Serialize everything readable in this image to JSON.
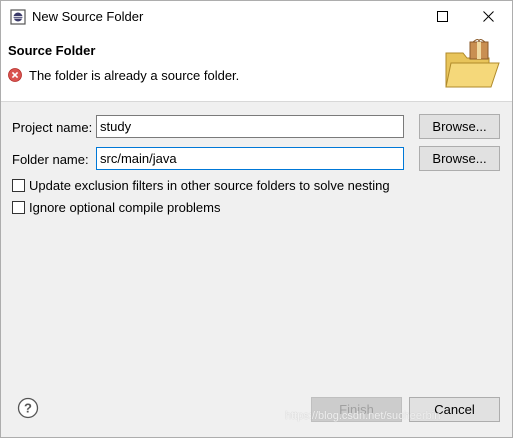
{
  "window": {
    "title": "New Source Folder"
  },
  "banner": {
    "title": "Source Folder",
    "message": "The folder is already a source folder."
  },
  "form": {
    "project_label": "Project name:",
    "project_value": "study",
    "folder_label": "Folder name:",
    "folder_value": "src/main/java",
    "browse_label": "Browse...",
    "option_update_exclusion": "Update exclusion filters in other source folders to solve nesting",
    "option_ignore_compile": "Ignore optional compile problems"
  },
  "footer": {
    "finish_label": "Finish",
    "cancel_label": "Cancel",
    "watermark": "https://blog.csdn.net/sucheerbin"
  },
  "icons": {
    "app": "eclipse-icon",
    "error": "error-icon",
    "banner": "folder-package-icon",
    "help": "help-icon",
    "maximize": "maximize-icon",
    "close": "close-icon"
  },
  "colors": {
    "error_red": "#d9534f",
    "focus_blue": "#0078d7"
  }
}
